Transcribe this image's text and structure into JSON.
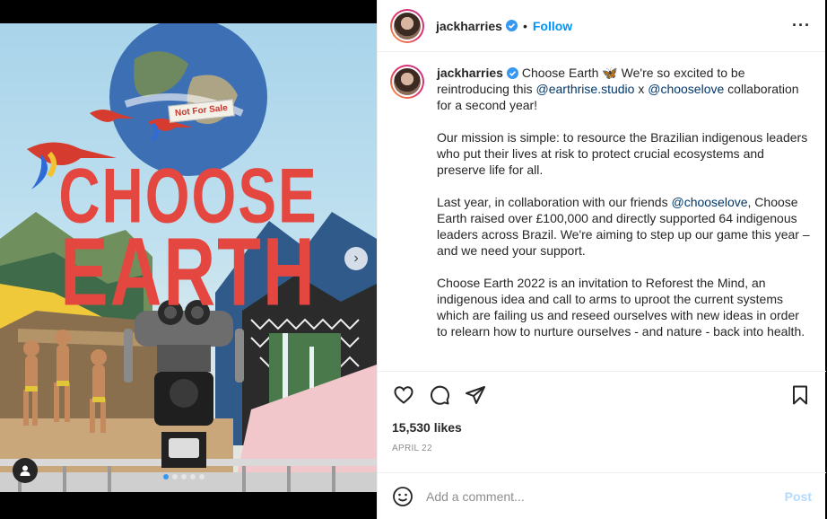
{
  "post": {
    "image": {
      "title_line1": "CHOOSE",
      "title_line2": "EARTH",
      "sign_text": "Not For Sale",
      "carousel_count": 5,
      "carousel_active": 1
    },
    "header": {
      "username": "jackharries",
      "separator": "•",
      "follow_label": "Follow",
      "more_icon": "more-options-icon"
    },
    "caption": {
      "username": "jackharries",
      "line1_text": " Choose Earth 🦋 We're so excited to be reintroducing this ",
      "mention1": "@earthrise.studio",
      "x_text": " x ",
      "mention2": "@chooselove",
      "line1_end": " collaboration for a second year!",
      "para2": "Our mission is simple: to resource the Brazilian indigenous leaders who put their lives at risk to protect crucial ecosystems and preserve life for all.",
      "para3_start": "Last year, in collaboration with our friends ",
      "para3_mention": "@chooselove",
      "para3_end": ", Choose Earth raised over £100,000 and directly supported 64 indigenous leaders across Brazil. We're aiming to step up our game this year – and we need your support.",
      "para4": "Choose Earth 2022 is an invitation to Reforest the Mind, an indigenous idea and call to arms to uproot the current systems which are failing us and reseed ourselves with new ideas in order to relearn how to nurture ourselves - and nature - back into health."
    },
    "actions": {
      "likes": "15,530 likes",
      "date": "APRIL 22"
    },
    "comment": {
      "placeholder": "Add a comment...",
      "post_label": "Post"
    },
    "colors": {
      "accent": "#0095f6",
      "title_red": "#e4473f"
    }
  }
}
